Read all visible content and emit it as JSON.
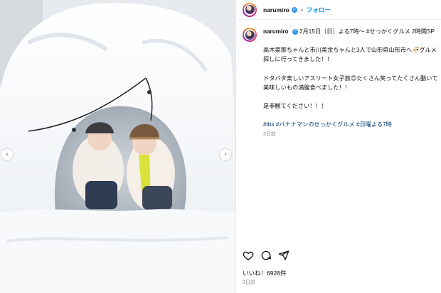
{
  "post": {
    "username": "narumiro",
    "follow_label": "フォロー",
    "separator": "•"
  },
  "caption": {
    "username": "narumiro",
    "line1": "2月15日（日）よる7時〜 #せっかくグルメ 2時間SP",
    "para1": "高木菜那ちゃんと市川美余ちゃんと3人で山形県山形市へ🍜グルメ探しに行ってきました！！",
    "para2": "ドタバタ楽しいアスリート女子旅😊たくさん笑ってたくさん動いて美味しいもの満腹食べました！！",
    "para3": "是非観てください！！！",
    "hashtags": "#tbs #バナナマンのせっかくグルメ #日曜よる7時",
    "age": "3日前"
  },
  "footer": {
    "likes": "いいね！6928件",
    "posted": "3日前"
  },
  "icons": {
    "like": "heart-icon",
    "comment": "comment-icon",
    "share": "share-icon",
    "prev": "chevron-left-icon",
    "next": "chevron-right-icon",
    "verified": "verified-badge-icon"
  },
  "colors": {
    "accent": "#0095f6",
    "verified": "#3897f0",
    "hashtag": "#00376b",
    "muted": "#8e8e8e"
  }
}
